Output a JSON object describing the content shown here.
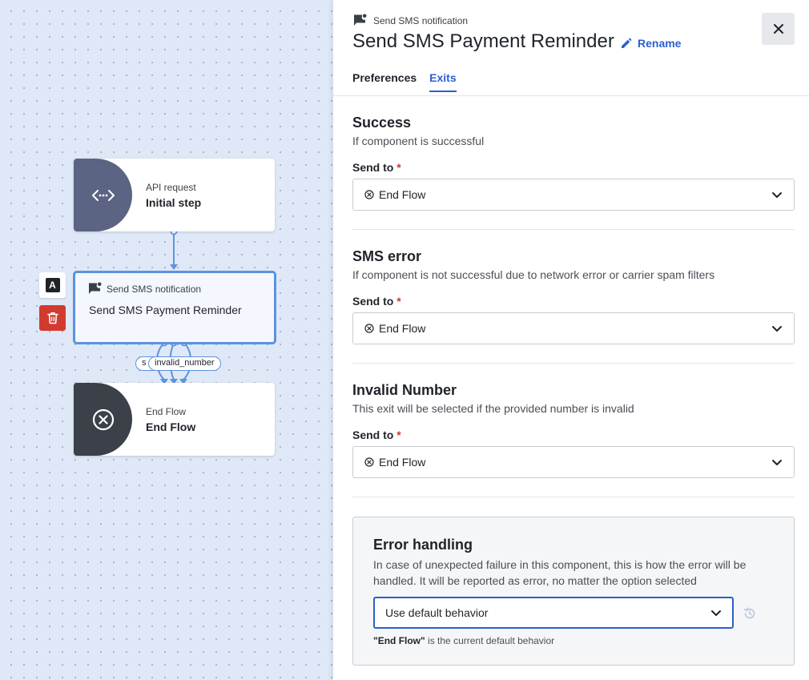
{
  "canvas": {
    "nodes": [
      {
        "id": "api",
        "type_label": "API request",
        "title": "Initial step",
        "icon": "code-brackets-icon",
        "badge_color": "#5c6483"
      },
      {
        "id": "sms",
        "type_label": "Send SMS notification",
        "title": "Send SMS Payment Reminder",
        "icon": "sms-chat-icon",
        "selected": true
      },
      {
        "id": "end",
        "type_label": "End Flow",
        "title": "End Flow",
        "icon": "close-circle-icon",
        "badge_color": "#3c4149"
      }
    ],
    "toolbar": {
      "annotate_label": "A"
    },
    "exit_labels": {
      "back": "s",
      "front": "invalid_number"
    }
  },
  "panel": {
    "component_type": "Send SMS notification",
    "title": "Send SMS Payment Reminder",
    "rename_label": "Rename",
    "tabs": [
      {
        "label": "Preferences",
        "active": false
      },
      {
        "label": "Exits",
        "active": true
      }
    ],
    "exits": [
      {
        "title": "Success",
        "description": "If component is successful",
        "send_to_label": "Send to",
        "required_mark": "*",
        "value": "End Flow"
      },
      {
        "title": "SMS error",
        "description": "If component is not successful due to network error or carrier spam filters",
        "send_to_label": "Send to",
        "required_mark": "*",
        "value": "End Flow"
      },
      {
        "title": "Invalid Number",
        "description": "This exit will be selected if the provided number is invalid",
        "send_to_label": "Send to",
        "required_mark": "*",
        "value": "End Flow"
      }
    ],
    "error_handling": {
      "title": "Error handling",
      "description": "In case of unexpected failure in this component, this is how the error will be handled. It will be reported as error, no matter the option selected",
      "selected": "Use default behavior",
      "note_strong": "\"End Flow\"",
      "note_rest": " is the current default behavior"
    }
  },
  "colors": {
    "accent": "#2b5fd0",
    "node_border": "#5b93de",
    "danger": "#d23a2e"
  }
}
